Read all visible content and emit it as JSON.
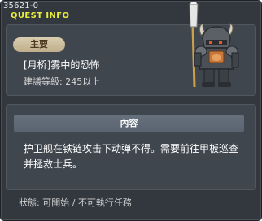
{
  "quest": {
    "id": "35621-0",
    "window_title": "QUEST INFO",
    "tag": "主要",
    "name": "[月桥]雾中的恐怖",
    "level_requirement": "建議等級: 245以上"
  },
  "content": {
    "header": "內容",
    "text": "护卫舰在铁链攻击下动弹不得。需要前往甲板巡查并拯救士兵。"
  },
  "status": "狀態: 可開始 / 不可執行任務",
  "colors": {
    "title_yellow": "#e8ec3a",
    "window_bg": "#33383f",
    "panel_bg": "#40464e",
    "tag_bg": "#cfc0a0",
    "header_bg": "#606b77"
  },
  "icons": {
    "quest_npc": "armored-knight-with-spear"
  }
}
